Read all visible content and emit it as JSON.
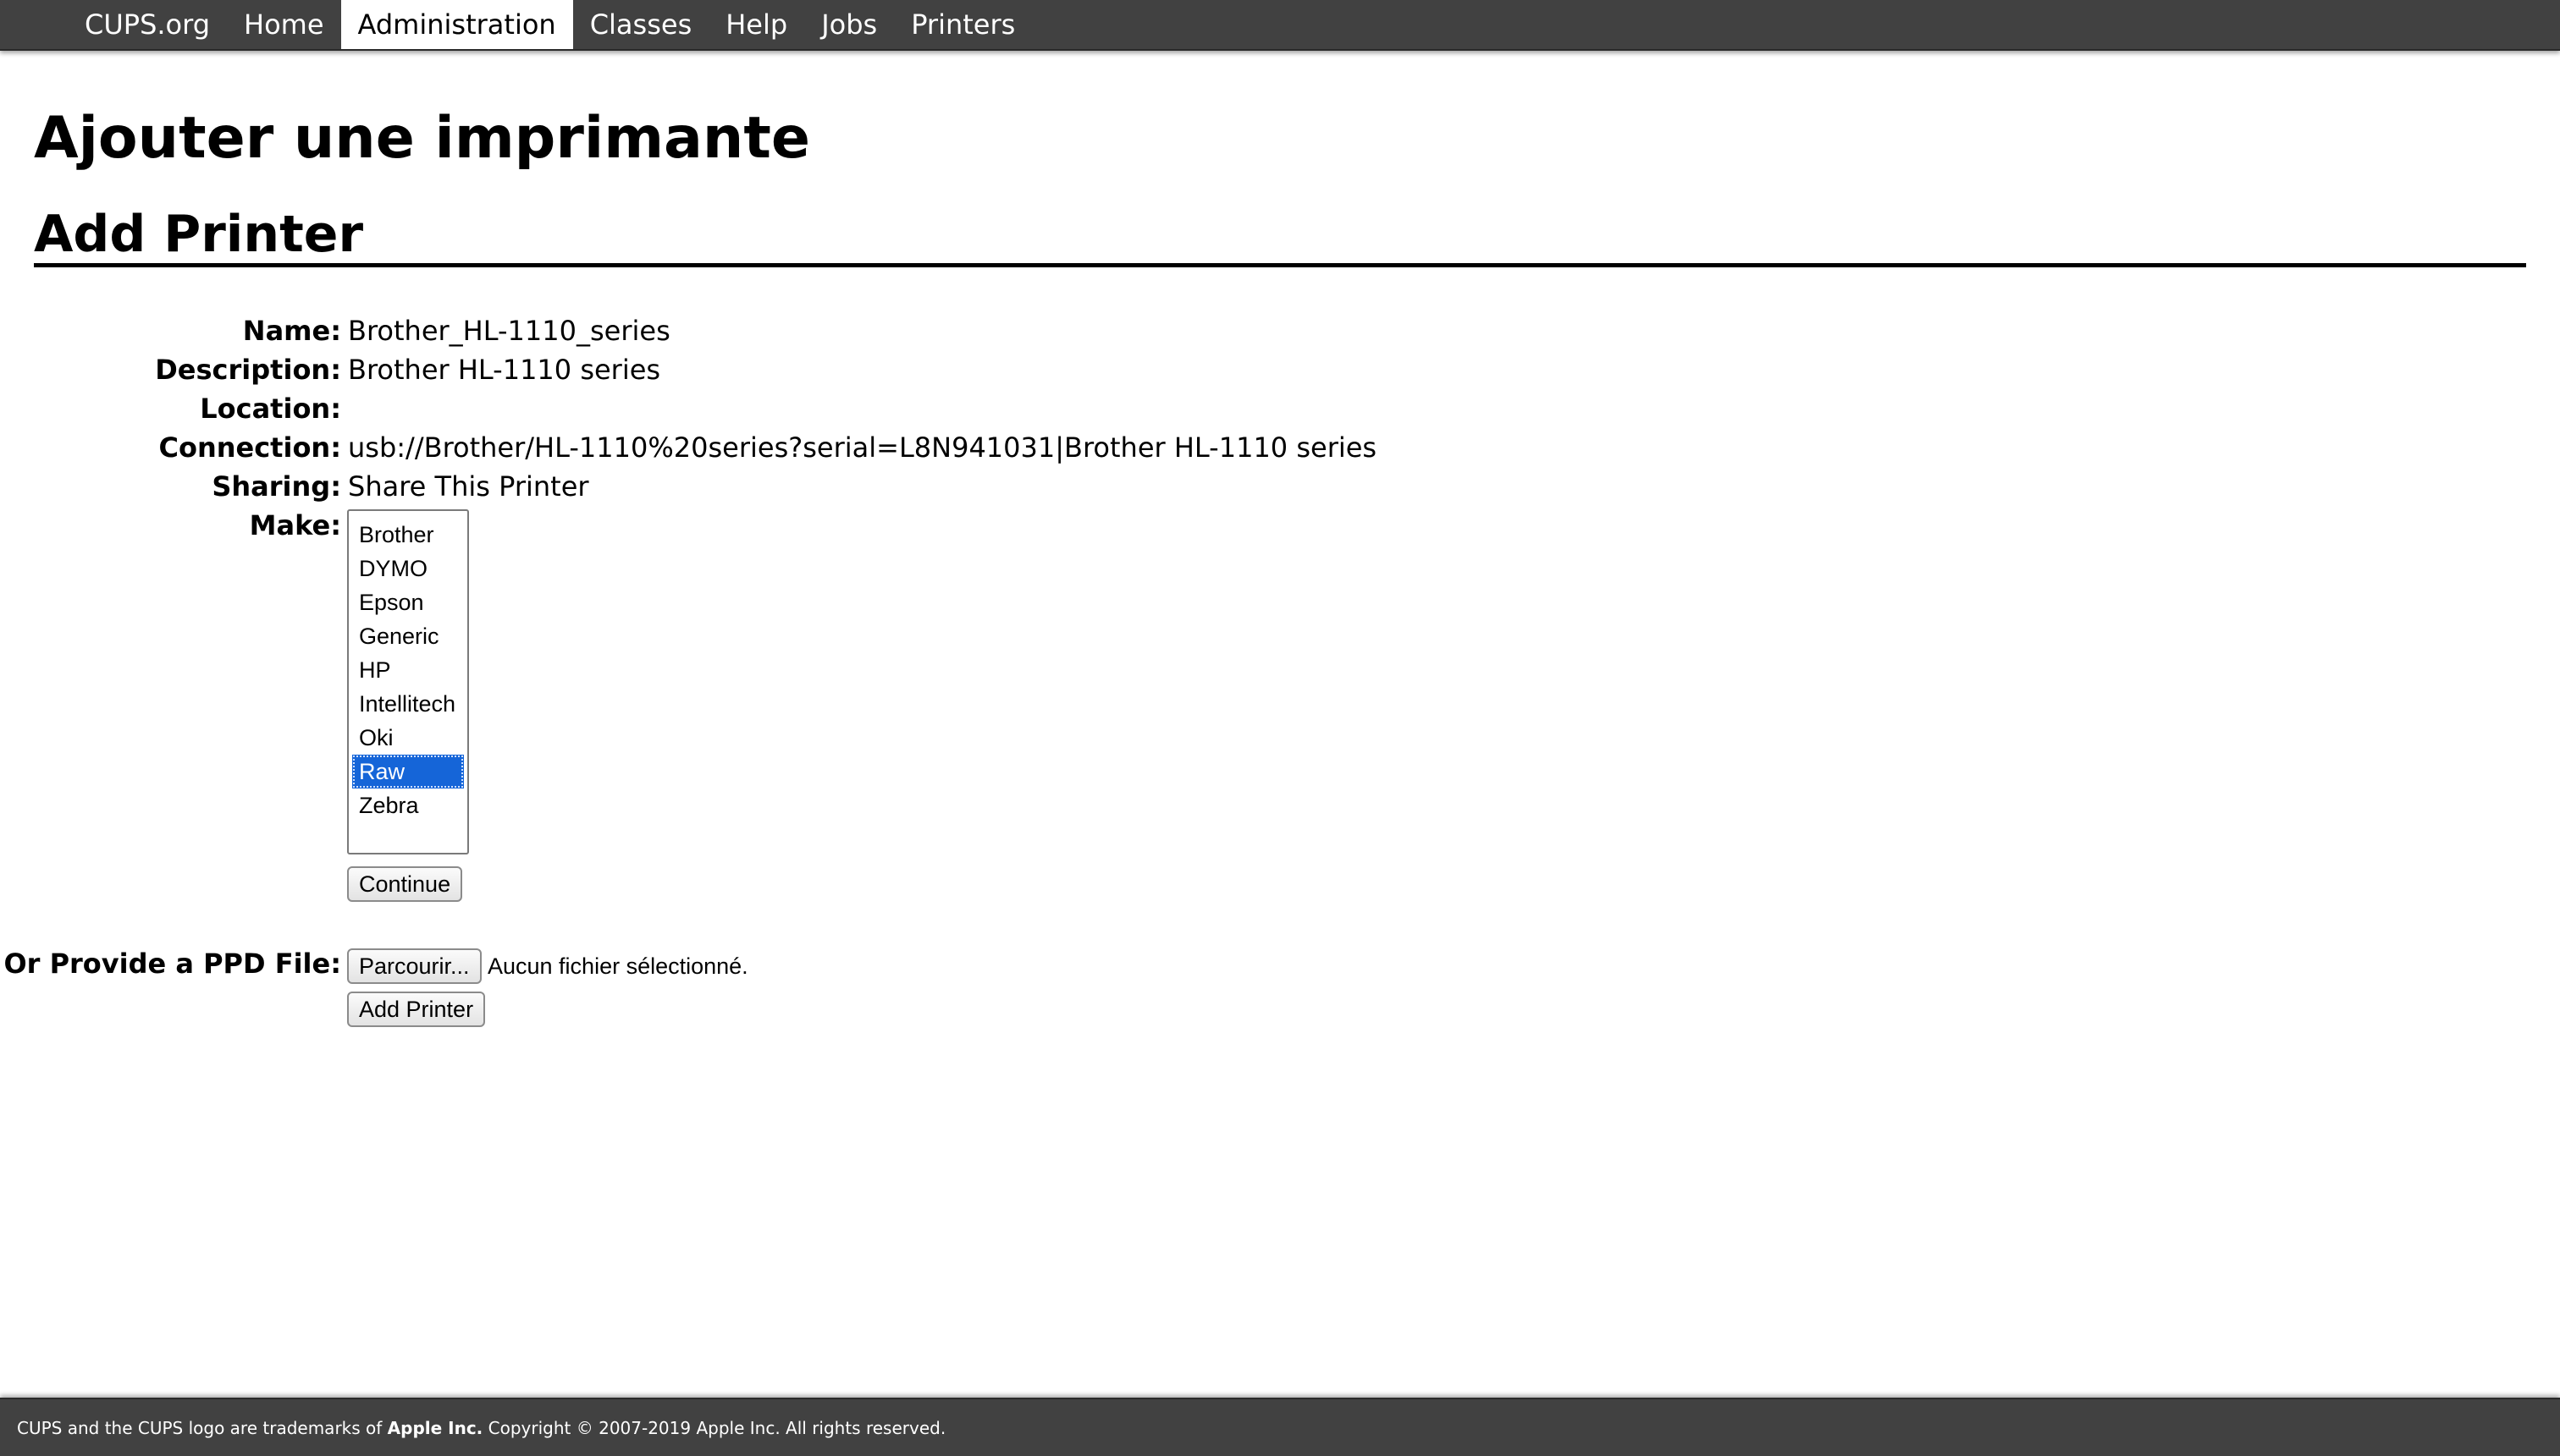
{
  "nav": {
    "items": [
      {
        "label": "CUPS.org",
        "active": false
      },
      {
        "label": "Home",
        "active": false
      },
      {
        "label": "Administration",
        "active": true
      },
      {
        "label": "Classes",
        "active": false
      },
      {
        "label": "Help",
        "active": false
      },
      {
        "label": "Jobs",
        "active": false
      },
      {
        "label": "Printers",
        "active": false
      }
    ]
  },
  "page": {
    "heading": "Ajouter une imprimante",
    "subheading": "Add Printer"
  },
  "form": {
    "name_label": "Name:",
    "name_value": "Brother_HL-1110_series",
    "description_label": "Description:",
    "description_value": "Brother HL-1110 series",
    "location_label": "Location:",
    "location_value": "",
    "connection_label": "Connection:",
    "connection_value": "usb://Brother/HL-1110%20series?serial=L8N941031|Brother HL-1110 series",
    "sharing_label": "Sharing:",
    "sharing_value": "Share This Printer",
    "make_label": "Make:",
    "make_options": [
      "Brother",
      "DYMO",
      "Epson",
      "Generic",
      "HP",
      "Intellitech",
      "Oki",
      "Raw",
      "Zebra"
    ],
    "make_selected": "Raw",
    "continue_button": "Continue",
    "ppd_label": "Or Provide a PPD File:",
    "browse_button": "Parcourir...",
    "file_status": "Aucun fichier sélectionné.",
    "add_printer_button": "Add Printer"
  },
  "footer": {
    "text_before": "CUPS and the CUPS logo are trademarks of ",
    "text_bold": "Apple Inc.",
    "text_after": " Copyright © 2007-2019 Apple Inc. All rights reserved."
  },
  "colors": {
    "bar_background": "#414141",
    "selection": "#1565d8",
    "nav_active_background": "#ffffff"
  }
}
